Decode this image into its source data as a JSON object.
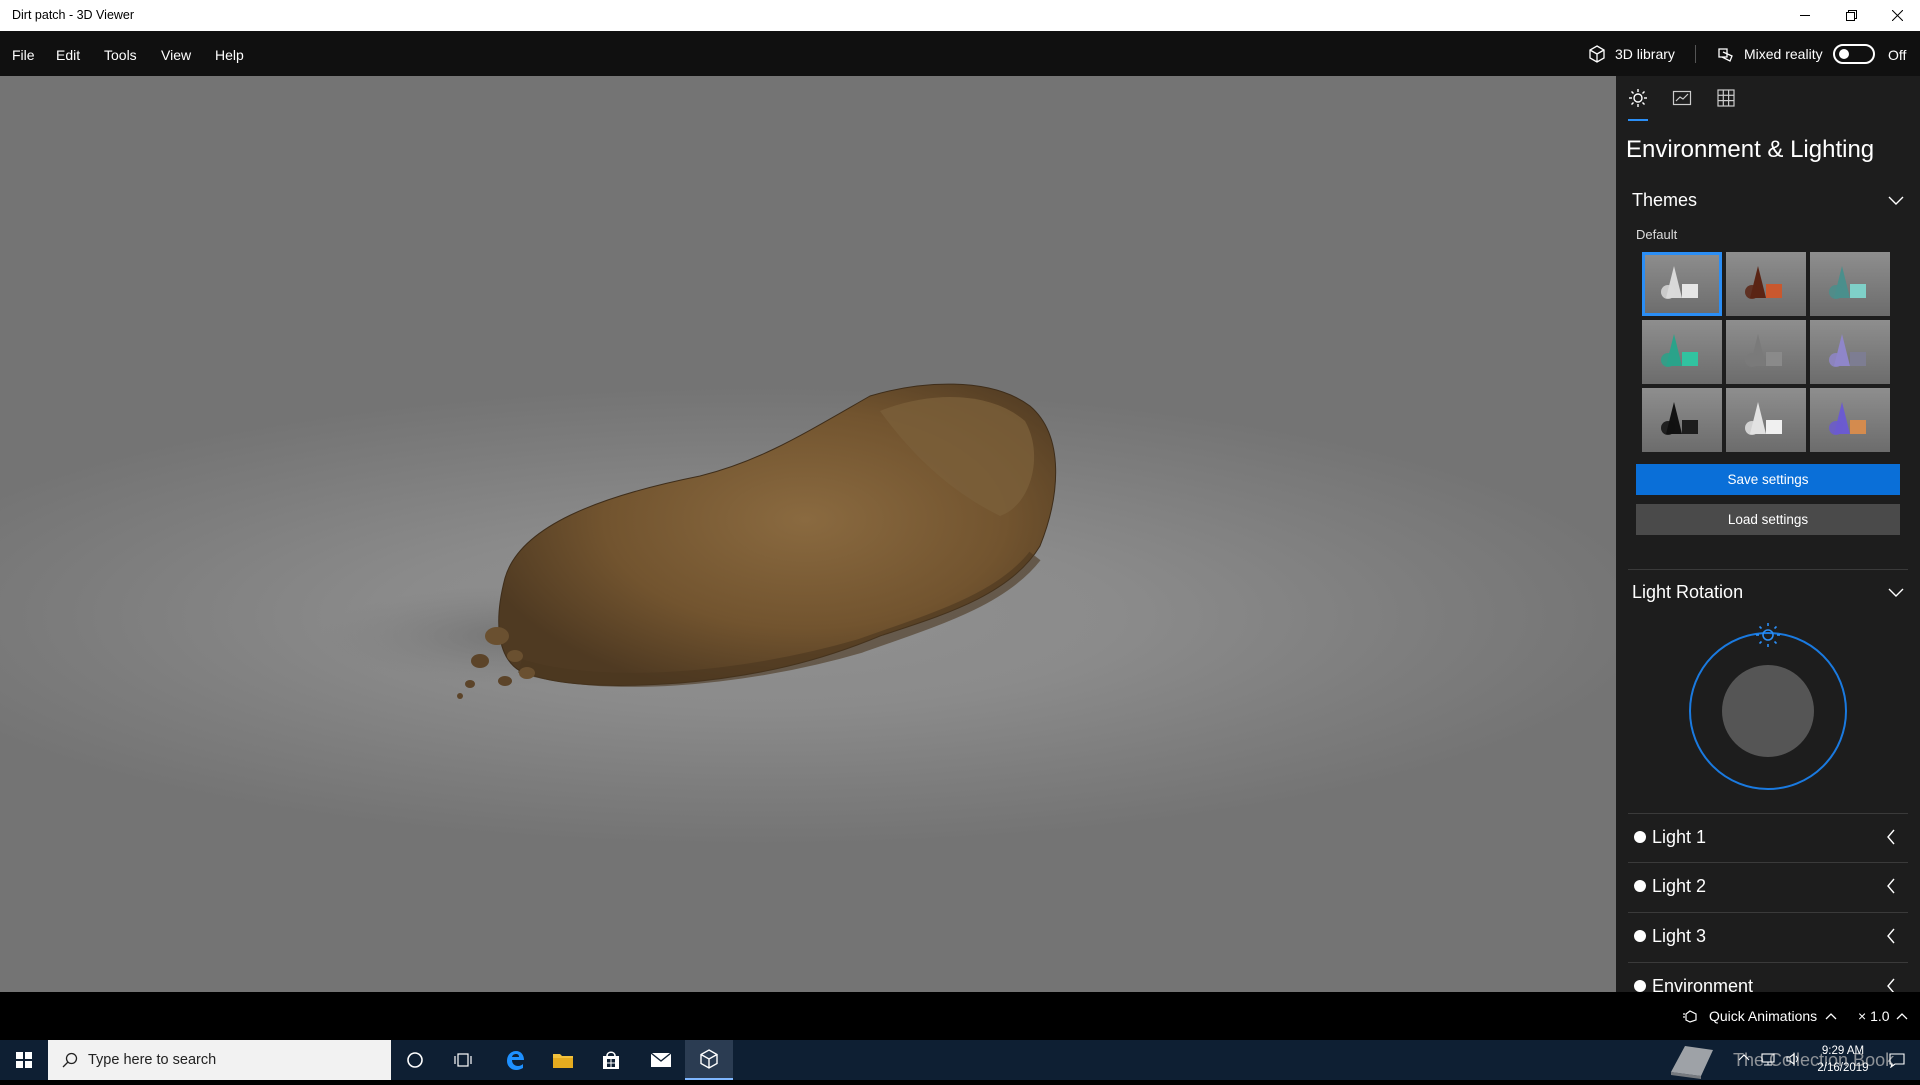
{
  "window": {
    "title": "Dirt patch - 3D Viewer"
  },
  "menu": [
    "File",
    "Edit",
    "Tools",
    "View",
    "Help"
  ],
  "header": {
    "library_label": "3D library",
    "mixed_reality_label": "Mixed reality",
    "toggle_state": "Off"
  },
  "panel": {
    "title": "Environment & Lighting",
    "themes": {
      "heading": "Themes",
      "selected_label": "Default",
      "thumbs": [
        {
          "name": "default",
          "shape": "#d9d9d9",
          "box": "#e6e6e6"
        },
        {
          "name": "warm",
          "shape": "#5a2414",
          "box": "#c9582e"
        },
        {
          "name": "teal",
          "shape": "#4a8f8c",
          "box": "#7fd0c8"
        },
        {
          "name": "green",
          "shape": "#2aa38a",
          "box": "#31c3a0"
        },
        {
          "name": "gray",
          "shape": "#7a7a7a",
          "box": "#8a8a8a"
        },
        {
          "name": "violet",
          "shape": "#8f86c9",
          "box": "#7d7d92"
        },
        {
          "name": "dark",
          "shape": "#111111",
          "box": "#1d1d1d"
        },
        {
          "name": "white",
          "shape": "#e2e2e2",
          "box": "#f0f0f0"
        },
        {
          "name": "purple-orange",
          "shape": "#6b5bd0",
          "box": "#d48b4e"
        }
      ]
    },
    "save_label": "Save settings",
    "load_label": "Load settings",
    "light_rotation": {
      "heading": "Light Rotation"
    },
    "lights": [
      "Light 1",
      "Light 2",
      "Light 3",
      "Environment"
    ]
  },
  "status": {
    "quick_animations": "Quick Animations",
    "speed": "× 1.0"
  },
  "taskbar": {
    "search_placeholder": "Type here to search",
    "time": "9:29 AM",
    "date": "2/16/2019",
    "watermark": "The Collection Book"
  },
  "colors": {
    "accent": "#2b8ef5",
    "save_button": "#0a6fd8",
    "load_button": "#4a4a4a",
    "panel_bg": "#1d1d1d"
  }
}
